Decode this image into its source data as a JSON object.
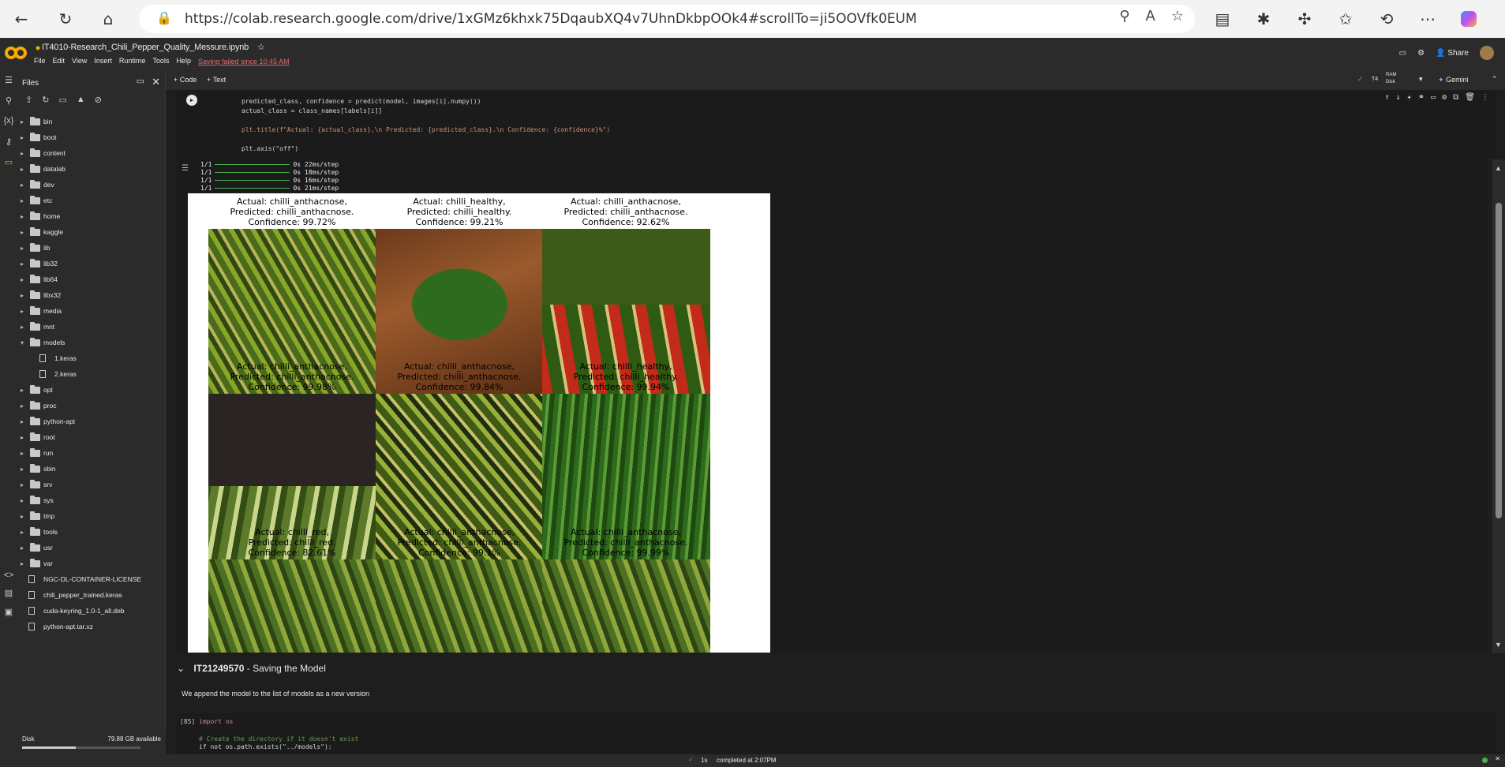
{
  "browser": {
    "url": "https://colab.research.google.com/drive/1xGMz6khxk75DqaubXQ4v7UhnDkbpOOk4#scrollTo=ji5OOVfk0EUM"
  },
  "header": {
    "notebook_title": "IT4010-Research_Chili_Pepper_Quality_Messure.ipynb",
    "menus": [
      "File",
      "Edit",
      "View",
      "Insert",
      "Runtime",
      "Tools",
      "Help"
    ],
    "save_status": "Saving failed since 10:45 AM",
    "share_label": "Share",
    "ram_label": "RAM",
    "disk_label": "Disk",
    "gemini_label": "Gemini",
    "t4_label": "T4"
  },
  "toolbar": {
    "code_label": "+ Code",
    "text_label": "+ Text"
  },
  "files": {
    "title": "Files",
    "items": [
      {
        "name": "bin",
        "type": "folder",
        "depth": 0,
        "expanded": false
      },
      {
        "name": "boot",
        "type": "folder",
        "depth": 0,
        "expanded": false
      },
      {
        "name": "content",
        "type": "folder",
        "depth": 0,
        "expanded": false
      },
      {
        "name": "datalab",
        "type": "folder",
        "depth": 0,
        "expanded": false
      },
      {
        "name": "dev",
        "type": "folder",
        "depth": 0,
        "expanded": false
      },
      {
        "name": "etc",
        "type": "folder",
        "depth": 0,
        "expanded": false
      },
      {
        "name": "home",
        "type": "folder",
        "depth": 0,
        "expanded": false
      },
      {
        "name": "kaggle",
        "type": "folder",
        "depth": 0,
        "expanded": false
      },
      {
        "name": "lib",
        "type": "folder",
        "depth": 0,
        "expanded": false
      },
      {
        "name": "lib32",
        "type": "folder",
        "depth": 0,
        "expanded": false
      },
      {
        "name": "lib64",
        "type": "folder",
        "depth": 0,
        "expanded": false
      },
      {
        "name": "libx32",
        "type": "folder",
        "depth": 0,
        "expanded": false
      },
      {
        "name": "media",
        "type": "folder",
        "depth": 0,
        "expanded": false
      },
      {
        "name": "mnt",
        "type": "folder",
        "depth": 0,
        "expanded": false
      },
      {
        "name": "models",
        "type": "folder",
        "depth": 0,
        "expanded": true
      },
      {
        "name": "1.keras",
        "type": "file",
        "depth": 1
      },
      {
        "name": "2.keras",
        "type": "file",
        "depth": 1
      },
      {
        "name": "opt",
        "type": "folder",
        "depth": 0,
        "expanded": false
      },
      {
        "name": "proc",
        "type": "folder",
        "depth": 0,
        "expanded": false
      },
      {
        "name": "python-apt",
        "type": "folder",
        "depth": 0,
        "expanded": false
      },
      {
        "name": "root",
        "type": "folder",
        "depth": 0,
        "expanded": false
      },
      {
        "name": "run",
        "type": "folder",
        "depth": 0,
        "expanded": false
      },
      {
        "name": "sbin",
        "type": "folder",
        "depth": 0,
        "expanded": false
      },
      {
        "name": "srv",
        "type": "folder",
        "depth": 0,
        "expanded": false
      },
      {
        "name": "sys",
        "type": "folder",
        "depth": 0,
        "expanded": false
      },
      {
        "name": "tmp",
        "type": "folder",
        "depth": 0,
        "expanded": false
      },
      {
        "name": "tools",
        "type": "folder",
        "depth": 0,
        "expanded": false
      },
      {
        "name": "usr",
        "type": "folder",
        "depth": 0,
        "expanded": false
      },
      {
        "name": "var",
        "type": "folder",
        "depth": 0,
        "expanded": false
      },
      {
        "name": "NGC-DL-CONTAINER-LICENSE",
        "type": "file",
        "depth": 0
      },
      {
        "name": "chili_pepper_trained.keras",
        "type": "file",
        "depth": 0
      },
      {
        "name": "cuda-keyring_1.0-1_all.deb",
        "type": "file",
        "depth": 0
      },
      {
        "name": "python-apt.tar.xz",
        "type": "file",
        "depth": 0
      }
    ],
    "disk_label": "Disk",
    "disk_available": "79.88 GB available",
    "disk_used_fraction": 0.45
  },
  "cell1": {
    "lines": [
      "predicted_class, confidence = predict(model, images[i].numpy())",
      "actual_class = class_names[labels[i]]",
      "",
      "plt.title(f\"Actual: {actual_class},\\n Predicted: {predicted_class}.\\n Confidence: {confidence}%\")",
      "",
      "plt.axis(\"off\")"
    ],
    "progress": [
      {
        "step": "1/1",
        "time": "0s 22ms/step"
      },
      {
        "step": "1/1",
        "time": "0s 18ms/step"
      },
      {
        "step": "1/1",
        "time": "0s 16ms/step"
      },
      {
        "step": "1/1",
        "time": "0s 21ms/step"
      }
    ]
  },
  "predictions": [
    {
      "actual": "Actual: chilli_anthacnose,",
      "predicted": "Predicted: chilli_anthacnose.",
      "confidence": "Confidence: 99.72%",
      "scene": "anthracnose-collage-green"
    },
    {
      "actual": "Actual: chilli_healthy,",
      "predicted": "Predicted: chilli_healthy.",
      "confidence": "Confidence: 99.21%",
      "scene": "jalapeno-on-wood"
    },
    {
      "actual": "Actual: chilli_anthacnose,",
      "predicted": "Predicted: chilli_anthacnose.",
      "confidence": "Confidence: 92.62%",
      "scene": "anthracnose-collage-red"
    },
    {
      "actual": "Actual: chilli_anthacnose,",
      "predicted": "Predicted: chilli_anthacnose.",
      "confidence": "Confidence: 99.98%",
      "scene": "anthracnose-collage-rotten"
    },
    {
      "actual": "Actual: chilli_anthacnose,",
      "predicted": "Predicted: chilli_anthacnose.",
      "confidence": "Confidence: 99.84%",
      "scene": "anthracnose-collage-spots"
    },
    {
      "actual": "Actual: chilli_healthy,",
      "predicted": "Predicted: chilli_healthy.",
      "confidence": "Confidence: 99.94%",
      "scene": "healthy-plant"
    },
    {
      "actual": "Actual: chilli_red,",
      "predicted": "Predicted: chilli_red.",
      "confidence": "Confidence: 82.61%",
      "scene": "partial"
    },
    {
      "actual": "Actual: chilli_anthacnose,",
      "predicted": "Predicted: chilli_anthacnose.",
      "confidence": "Confidence: 99.1%",
      "scene": "partial"
    },
    {
      "actual": "Actual: chilli_anthacnose,",
      "predicted": "Predicted: chilli_anthacnose.",
      "confidence": "Confidence: 99.99%",
      "scene": "partial"
    }
  ],
  "section": {
    "id": "IT21249570",
    "title": " - Saving the Model",
    "text": "We append the model to the list of models as a new version"
  },
  "cell2": {
    "exec_count": "[85]",
    "lines": [
      "import os",
      "",
      "# Create the directory if it doesn't exist",
      "if not os.path.exists(\"../models\"):"
    ]
  },
  "status": {
    "duration": "1s",
    "completed": "completed at 2:07PM"
  }
}
